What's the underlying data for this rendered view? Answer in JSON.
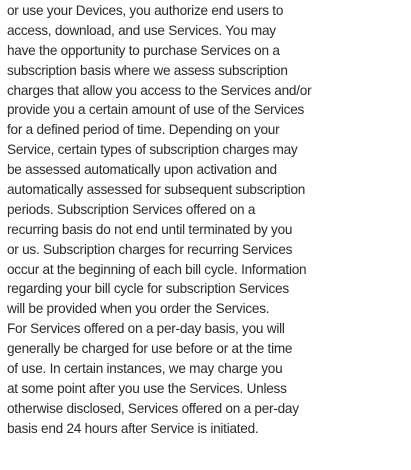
{
  "document": {
    "lines": [
      "or use your Devices, you authorize end users to",
      "access, download, and use Services. You may",
      "have the opportunity to purchase Services on a",
      "subscription basis where we assess subscription",
      "charges that allow you access to the Services and/or",
      "provide you a certain amount of use of the Services",
      "for a defined period of time. Depending on your",
      "Service, certain types of subscription charges may",
      "be assessed automatically upon activation and",
      "automatically assessed for subsequent subscription",
      "periods. Subscription Services offered on a",
      "recurring basis do not end until terminated by you",
      "or us. Subscription charges for recurring Services",
      "occur at the beginning of each bill cycle. Information",
      "regarding your bill cycle for subscription Services",
      "will be provided when you order the Services.",
      "For Services offered on a per-day basis, you will",
      "generally be charged for use before or at the time",
      "of use. In certain instances, we may charge you",
      "at some point after you use the Services. Unless",
      "otherwise disclosed, Services offered on a per-day",
      "basis end 24 hours after Service is initiated."
    ]
  }
}
